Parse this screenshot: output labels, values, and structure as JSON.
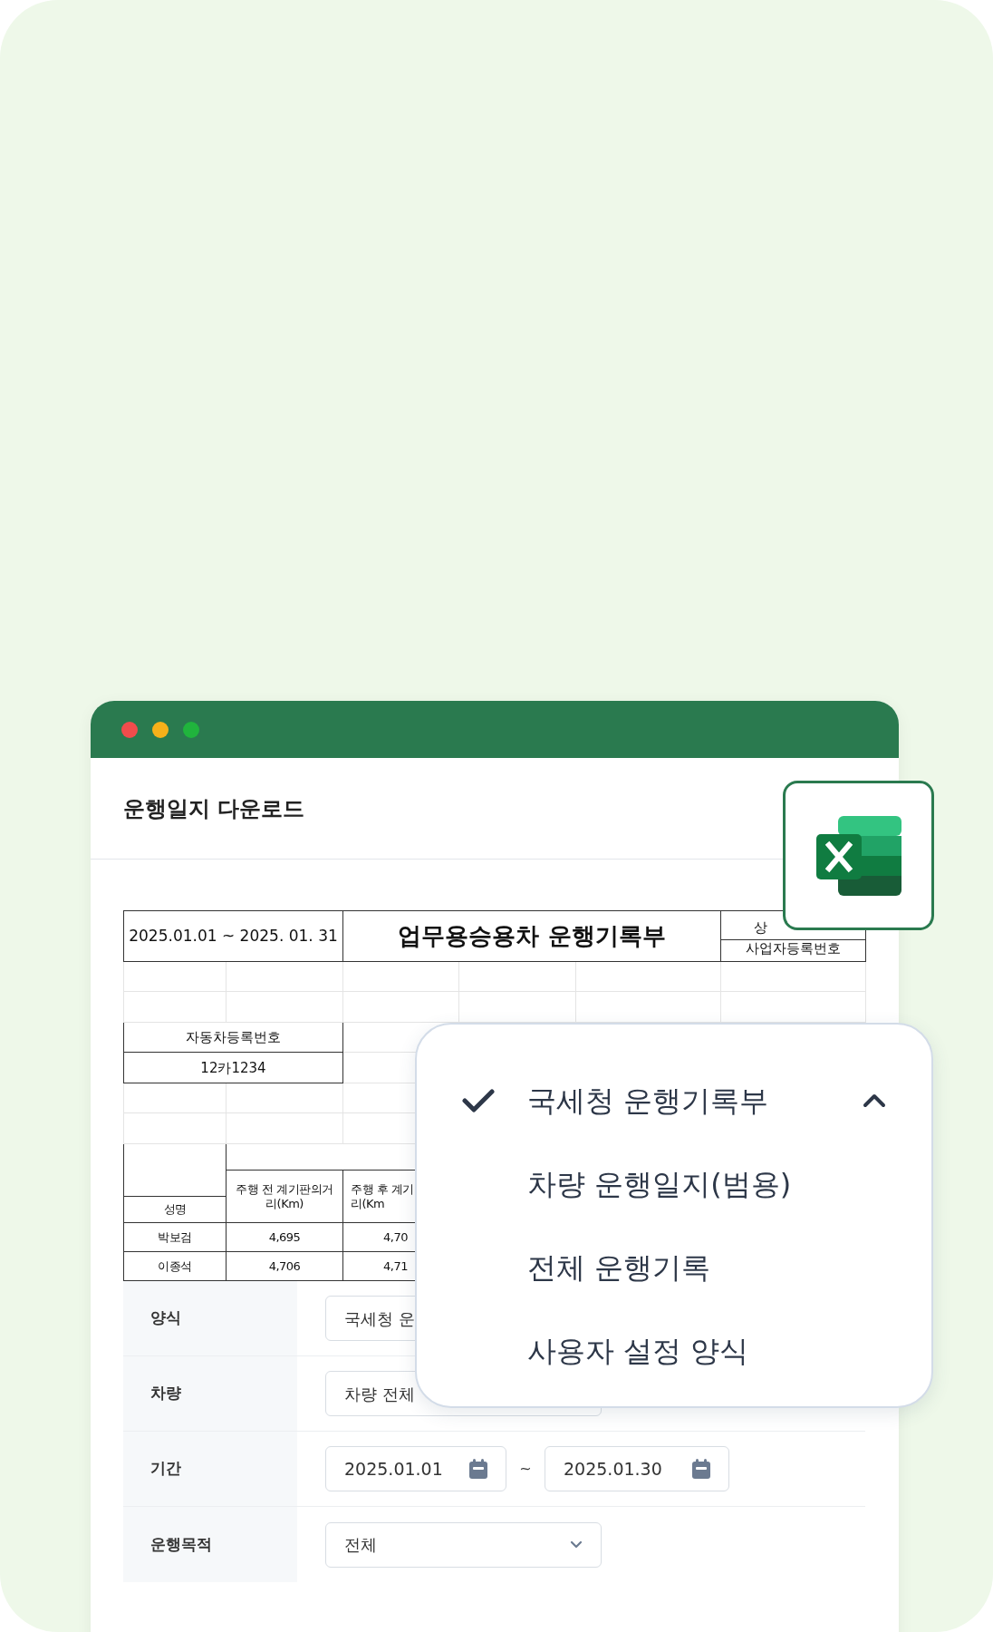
{
  "window": {
    "title": "운행일지 다운로드"
  },
  "sheet": {
    "period": "2025.01.01 ~ 2025. 01. 31",
    "title": "업무용승용차 운행기록부",
    "corner_top": "상",
    "corner_bottom": "사업자등록번호",
    "vehicle_label": "자동차등록번호",
    "vehicle_number": "12카1234",
    "columns": [
      {
        "lines": [
          "성명"
        ]
      },
      {
        "lines": [
          "주행 전 계기판의거",
          "리(Km)"
        ]
      },
      {
        "lines": [
          "주행 후 계기",
          "리(Km"
        ]
      }
    ],
    "rows": [
      [
        "박보검",
        "4,695",
        "4,70"
      ],
      [
        "이종석",
        "4,706",
        "4,71"
      ]
    ]
  },
  "form": [
    {
      "label": "양식",
      "kind": "select",
      "value": "국세청 운",
      "arrow": false
    },
    {
      "label": "차량",
      "kind": "select",
      "value": "차량 전체",
      "arrow": false
    },
    {
      "label": "기간",
      "kind": "date_range",
      "start": "2025.01.01",
      "separator": "~",
      "end": "2025.01.30"
    },
    {
      "label": "운행목적",
      "kind": "select",
      "value": "전체",
      "arrow": true
    }
  ],
  "dropdown": {
    "expanded": true,
    "options": [
      {
        "label": "국세청 운행기록부",
        "selected": true
      },
      {
        "label": "차량 운행일지(범용)",
        "selected": false
      },
      {
        "label": "전체 운행기록",
        "selected": false
      },
      {
        "label": "사용자 설정 양식",
        "selected": false
      }
    ]
  }
}
